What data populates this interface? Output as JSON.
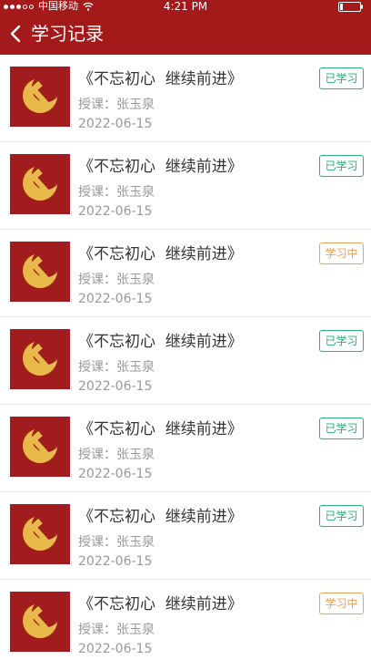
{
  "status_bar": {
    "carrier": "中国移动",
    "time": "4:21 PM",
    "icons": [
      "signal-dots-icon",
      "wifi-icon",
      "battery-icon"
    ]
  },
  "nav": {
    "title": "学习记录",
    "back_icon": "chevron-left-icon"
  },
  "colors": {
    "header_bg": "#a41a1a",
    "completed": "#27b07a",
    "in_progress": "#f0a050"
  },
  "records": [
    {
      "title": "《不忘初心  继续前进》",
      "teacher": "授课：张玉泉",
      "date": "2022-06-15",
      "status": "已学习",
      "status_color": "#27b07a"
    },
    {
      "title": "《不忘初心  继续前进》",
      "teacher": "授课：张玉泉",
      "date": "2022-06-15",
      "status": "已学习",
      "status_color": "#27b07a"
    },
    {
      "title": "《不忘初心  继续前进》",
      "teacher": "授课：张玉泉",
      "date": "2022-06-15",
      "status": "学习中",
      "status_color": "#f0a050"
    },
    {
      "title": "《不忘初心  继续前进》",
      "teacher": "授课：张玉泉",
      "date": "2022-06-15",
      "status": "已学习",
      "status_color": "#27b07a"
    },
    {
      "title": "《不忘初心  继续前进》",
      "teacher": "授课：张玉泉",
      "date": "2022-06-15",
      "status": "已学习",
      "status_color": "#27b07a"
    },
    {
      "title": "《不忘初心  继续前进》",
      "teacher": "授课：张玉泉",
      "date": "2022-06-15",
      "status": "已学习",
      "status_color": "#27b07a"
    },
    {
      "title": "《不忘初心  继续前进》",
      "teacher": "授课：张玉泉",
      "date": "2022-06-15",
      "status": "学习中",
      "status_color": "#f0a050"
    }
  ]
}
